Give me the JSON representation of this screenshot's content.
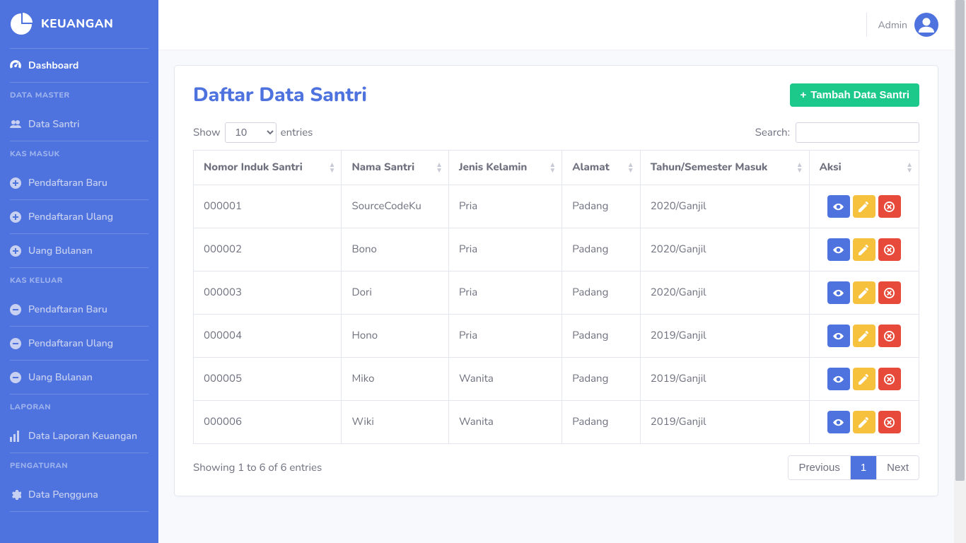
{
  "brand": {
    "name": "KEUANGAN"
  },
  "topbar": {
    "user": "Admin"
  },
  "sidebar": {
    "dashboard": "Dashboard",
    "groups": [
      {
        "heading": "DATA MASTER",
        "items": [
          {
            "label": "Data Santri",
            "icon": "users"
          }
        ]
      },
      {
        "heading": "KAS MASUK",
        "items": [
          {
            "label": "Pendaftaran Baru",
            "icon": "plus-circle"
          },
          {
            "label": "Pendaftaran Ulang",
            "icon": "plus-circle"
          },
          {
            "label": "Uang Bulanan",
            "icon": "plus-circle"
          }
        ]
      },
      {
        "heading": "KAS KELUAR",
        "items": [
          {
            "label": "Pendaftaran Baru",
            "icon": "minus-circle"
          },
          {
            "label": "Pendaftaran Ulang",
            "icon": "minus-circle"
          },
          {
            "label": "Uang Bulanan",
            "icon": "minus-circle"
          }
        ]
      },
      {
        "heading": "LAPORAN",
        "items": [
          {
            "label": "Data Laporan Keuangan",
            "icon": "chart"
          }
        ]
      },
      {
        "heading": "PENGATURAN",
        "items": [
          {
            "label": "Data Pengguna",
            "icon": "cog"
          }
        ]
      }
    ]
  },
  "page": {
    "title": "Daftar Data Santri",
    "add_button": "Tambah Data Santri"
  },
  "datatable": {
    "show_label_pre": "Show",
    "show_label_post": "entries",
    "length": "10",
    "search_label": "Search:",
    "columns": [
      "Nomor Induk Santri",
      "Nama Santri",
      "Jenis Kelamin",
      "Alamat",
      "Tahun/Semester Masuk",
      "Aksi"
    ],
    "rows": [
      {
        "nis": "000001",
        "nama": "SourceCodeKu",
        "jk": "Pria",
        "alamat": "Padang",
        "tahun": "2020/Ganjil"
      },
      {
        "nis": "000002",
        "nama": "Bono",
        "jk": "Pria",
        "alamat": "Padang",
        "tahun": "2020/Ganjil"
      },
      {
        "nis": "000003",
        "nama": "Dori",
        "jk": "Pria",
        "alamat": "Padang",
        "tahun": "2020/Ganjil"
      },
      {
        "nis": "000004",
        "nama": "Hono",
        "jk": "Pria",
        "alamat": "Padang",
        "tahun": "2019/Ganjil"
      },
      {
        "nis": "000005",
        "nama": "Miko",
        "jk": "Wanita",
        "alamat": "Padang",
        "tahun": "2019/Ganjil"
      },
      {
        "nis": "000006",
        "nama": "Wiki",
        "jk": "Wanita",
        "alamat": "Padang",
        "tahun": "2019/Ganjil"
      }
    ],
    "info": "Showing 1 to 6 of 6 entries",
    "pager": {
      "prev": "Previous",
      "next": "Next",
      "pages": [
        "1"
      ],
      "active": "1"
    }
  }
}
